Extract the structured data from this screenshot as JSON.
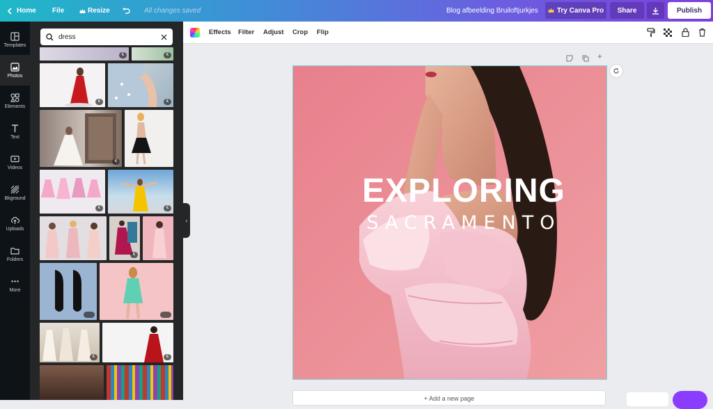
{
  "topbar": {
    "home_label": "Home",
    "file_label": "File",
    "resize_label": "Resize",
    "save_status": "All changes saved",
    "design_title": "Blog afbeelding Bruiloftjurkjes",
    "try_pro_label": "Try Canva Pro",
    "share_label": "Share",
    "publish_label": "Publish"
  },
  "sidebar": {
    "items": [
      {
        "label": "Templates",
        "icon": "templates-icon"
      },
      {
        "label": "Photos",
        "icon": "photos-icon"
      },
      {
        "label": "Elements",
        "icon": "elements-icon"
      },
      {
        "label": "Text",
        "icon": "text-icon"
      },
      {
        "label": "Videos",
        "icon": "videos-icon"
      },
      {
        "label": "Bkground",
        "icon": "background-icon"
      },
      {
        "label": "Uploads",
        "icon": "uploads-icon"
      },
      {
        "label": "Folders",
        "icon": "folders-icon"
      },
      {
        "label": "More",
        "icon": "more-icon"
      }
    ],
    "active": "Photos"
  },
  "panel": {
    "search_value": "dress"
  },
  "editbar": {
    "effects_label": "Effects",
    "filter_label": "Filter",
    "adjust_label": "Adjust",
    "crop_label": "Crop",
    "flip_label": "Flip"
  },
  "canvas": {
    "title": "EXPLORING",
    "subtitle": "SACRAMENTO",
    "add_page_label": "+ Add a new page"
  },
  "colors": {
    "accent": "#8b3dff",
    "canvas_bg": "#e8808a",
    "dress": "#f3b9c6",
    "hair": "#2a1a14"
  }
}
